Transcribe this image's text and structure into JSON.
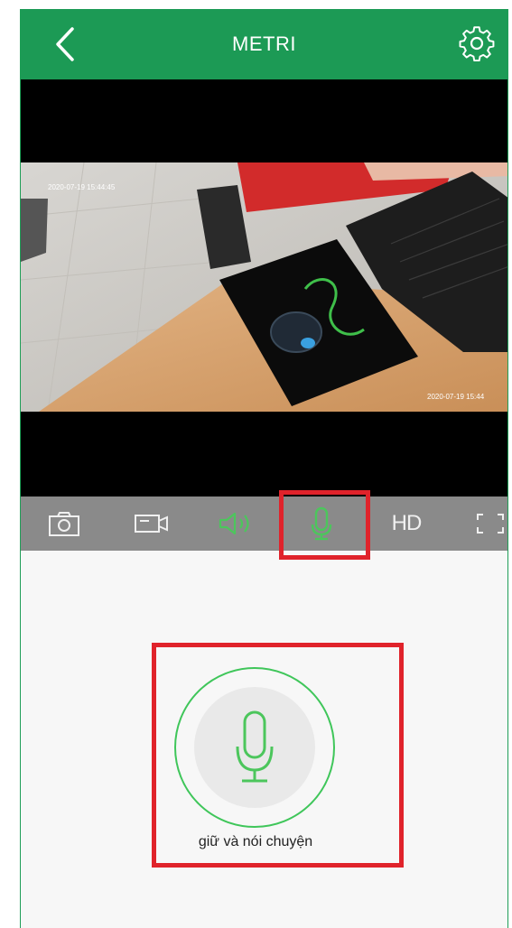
{
  "header": {
    "title": "METRI",
    "back_icon": "chevron-left-icon",
    "settings_icon": "gear-icon"
  },
  "video": {
    "timestamp_top": "2020-07-19 15:44:45",
    "timestamp_bottom": "2020-07-19 15:44"
  },
  "toolbar": {
    "items": [
      "camera-icon",
      "video-record-icon",
      "speaker-icon",
      "microphone-icon",
      "HD",
      "fullscreen-icon"
    ],
    "hd_label": "HD",
    "active_color": "#4cc65c",
    "inactive_color": "#f0f0f0"
  },
  "talk": {
    "label": "giữ và nói chuyện",
    "icon": "microphone-icon"
  },
  "colors": {
    "brand": "#1c9a55",
    "highlight": "#e0232b",
    "accent": "#3fc65a"
  }
}
